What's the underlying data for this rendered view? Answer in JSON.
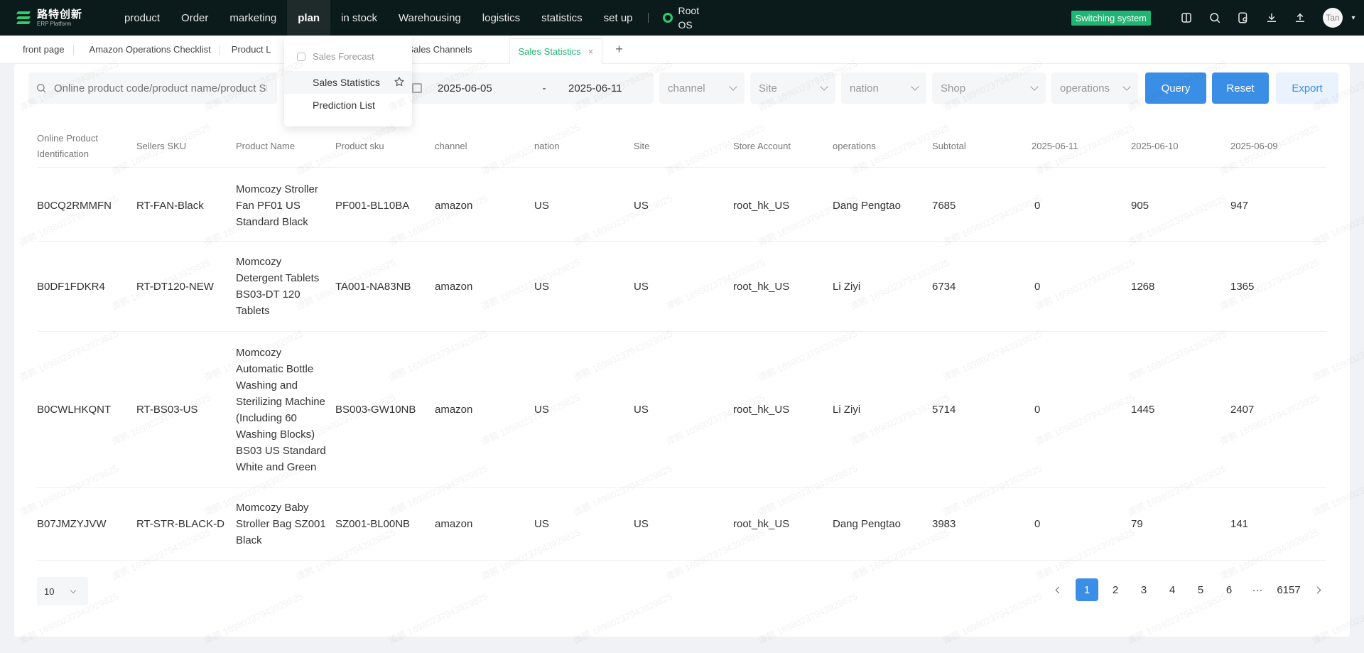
{
  "app": {
    "logo_cn": "路特创新",
    "logo_en": "ERP Platform"
  },
  "nav": {
    "items": [
      "product",
      "Order",
      "marketing",
      "plan",
      "in stock",
      "Warehousing",
      "logistics",
      "statistics",
      "set up"
    ],
    "active": "plan",
    "root_os_line1": "Root",
    "root_os_line2": "OS"
  },
  "header": {
    "switch_label": "Switching system",
    "avatar_text": "Tan"
  },
  "tabs": {
    "items": [
      "front page",
      "Amazon Operations Checklist",
      "Product L",
      "Sales Channels",
      "Sales Statistics"
    ],
    "active": "Sales Statistics",
    "close": "×",
    "add": "+"
  },
  "dropdown": {
    "header": "Sales Forecast",
    "items": [
      "Sales Statistics",
      "Prediction List"
    ]
  },
  "filters": {
    "search_placeholder": "Online product code/product name/product SKU",
    "date_start": "2025-06-05",
    "date_sep": "-",
    "date_end": "2025-06-11",
    "channel": "channel",
    "site": "Site",
    "nation": "nation",
    "shop": "Shop",
    "operations": "operations",
    "query": "Query",
    "reset": "Reset",
    "export": "Export"
  },
  "table": {
    "headers": [
      "Online Product Identification",
      "Sellers SKU",
      "Product Name",
      "Product sku",
      "channel",
      "nation",
      "Site",
      "Store Account",
      "operations",
      "Subtotal",
      "2025-06-11",
      "2025-06-10",
      "2025-06-09"
    ],
    "rows": [
      [
        "B0CQ2RMMFN",
        "RT-FAN-Black",
        "Momcozy Stroller Fan PF01 US Standard Black",
        "PF001-BL10BA",
        "amazon",
        "US",
        "US",
        "root_hk_US",
        "Dang Pengtao",
        "7685",
        "0",
        "905",
        "947"
      ],
      [
        "B0DF1FDKR4",
        "RT-DT120-NEW",
        "Momcozy Detergent Tablets BS03-DT 120 Tablets",
        "TA001-NA83NB",
        "amazon",
        "US",
        "US",
        "root_hk_US",
        "Li Ziyi",
        "6734",
        "0",
        "1268",
        "1365"
      ],
      [
        "B0CWLHKQNT",
        "RT-BS03-US",
        "Momcozy Automatic Bottle Washing and Sterilizing Machine (Including 60 Washing Blocks) BS03 US Standard White and Green",
        "BS003-GW10NB",
        "amazon",
        "US",
        "US",
        "root_hk_US",
        "Li Ziyi",
        "5714",
        "0",
        "1445",
        "2407"
      ],
      [
        "B07JMZYJVW",
        "RT-STR-BLACK-D",
        "Momcozy Baby Stroller Bag SZ001 Black",
        "SZ001-BL00NB",
        "amazon",
        "US",
        "US",
        "root_hk_US",
        "Dang Pengtao",
        "3983",
        "0",
        "79",
        "141"
      ]
    ]
  },
  "pagination": {
    "page_size": "10",
    "pages": [
      "1",
      "2",
      "3",
      "4",
      "5",
      "6"
    ],
    "ellipsis": "···",
    "last": "6157",
    "current": "1"
  },
  "watermark": "谭鹏 16980237943929825",
  "colors": {
    "brand_green": "#21b573",
    "primary_blue": "#3a8ee6",
    "topbar": "#0b1a1a"
  }
}
